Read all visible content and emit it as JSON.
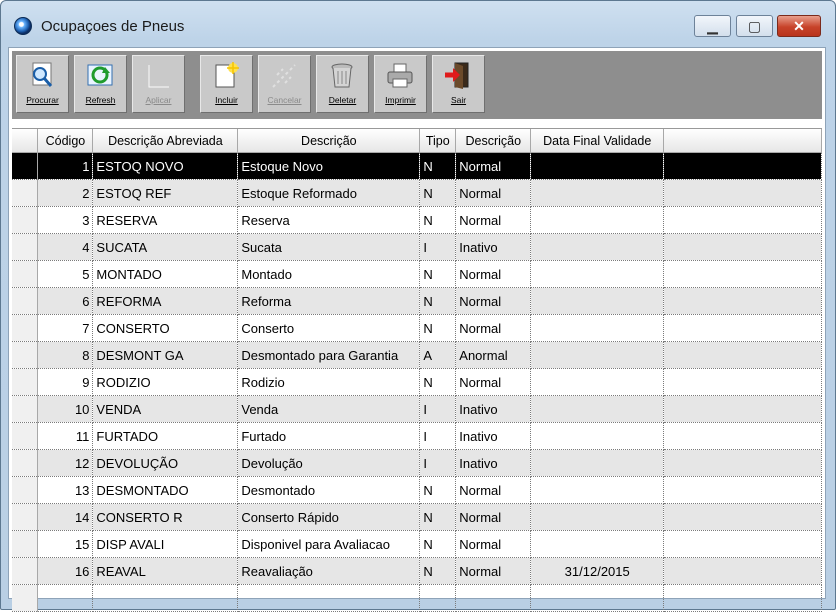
{
  "window": {
    "title": "Ocupaçoes de Pneus"
  },
  "toolbar": {
    "buttons": [
      {
        "label": "Procurar",
        "icon": "search-icon",
        "enabled": true
      },
      {
        "label": "Refresh",
        "icon": "refresh-icon",
        "enabled": true
      },
      {
        "label": "Aplicar",
        "icon": "apply-icon",
        "enabled": false
      },
      {
        "label": "Incluir",
        "icon": "new-document-icon",
        "enabled": true
      },
      {
        "label": "Cancelar",
        "icon": "cancel-icon",
        "enabled": false
      },
      {
        "label": "Deletar",
        "icon": "trash-icon",
        "enabled": true
      },
      {
        "label": "Imprimir",
        "icon": "printer-icon",
        "enabled": true
      },
      {
        "label": "Sair",
        "icon": "exit-door-icon",
        "enabled": true
      }
    ]
  },
  "grid": {
    "columns": [
      "Código",
      "Descrição Abreviada",
      "Descrição",
      "Tipo",
      "Descrição",
      "Data Final Validade"
    ],
    "selected_row": 0,
    "rows": [
      {
        "codigo": "1",
        "abrev": "ESTOQ NOVO",
        "descricao": "Estoque Novo",
        "tipo": "N",
        "tipo_desc": "Normal",
        "data": ""
      },
      {
        "codigo": "2",
        "abrev": "ESTOQ REF",
        "descricao": "Estoque Reformado",
        "tipo": "N",
        "tipo_desc": "Normal",
        "data": ""
      },
      {
        "codigo": "3",
        "abrev": "RESERVA",
        "descricao": "Reserva",
        "tipo": "N",
        "tipo_desc": "Normal",
        "data": ""
      },
      {
        "codigo": "4",
        "abrev": "SUCATA",
        "descricao": "Sucata",
        "tipo": "I",
        "tipo_desc": "Inativo",
        "data": ""
      },
      {
        "codigo": "5",
        "abrev": "MONTADO",
        "descricao": "Montado",
        "tipo": "N",
        "tipo_desc": "Normal",
        "data": ""
      },
      {
        "codigo": "6",
        "abrev": "REFORMA",
        "descricao": "Reforma",
        "tipo": "N",
        "tipo_desc": "Normal",
        "data": ""
      },
      {
        "codigo": "7",
        "abrev": "CONSERTO",
        "descricao": "Conserto",
        "tipo": "N",
        "tipo_desc": "Normal",
        "data": ""
      },
      {
        "codigo": "8",
        "abrev": "DESMONT GA",
        "descricao": "Desmontado para Garantia",
        "tipo": "A",
        "tipo_desc": "Anormal",
        "data": ""
      },
      {
        "codigo": "9",
        "abrev": "RODIZIO",
        "descricao": "Rodizio",
        "tipo": "N",
        "tipo_desc": "Normal",
        "data": ""
      },
      {
        "codigo": "10",
        "abrev": "VENDA",
        "descricao": "Venda",
        "tipo": "I",
        "tipo_desc": "Inativo",
        "data": ""
      },
      {
        "codigo": "11",
        "abrev": "FURTADO",
        "descricao": "Furtado",
        "tipo": "I",
        "tipo_desc": "Inativo",
        "data": ""
      },
      {
        "codigo": "12",
        "abrev": "DEVOLUÇÃO",
        "descricao": "Devolução",
        "tipo": "I",
        "tipo_desc": "Inativo",
        "data": ""
      },
      {
        "codigo": "13",
        "abrev": "DESMONTADO",
        "descricao": "Desmontado",
        "tipo": "N",
        "tipo_desc": "Normal",
        "data": ""
      },
      {
        "codigo": "14",
        "abrev": "CONSERTO R",
        "descricao": "Conserto Rápido",
        "tipo": "N",
        "tipo_desc": "Normal",
        "data": ""
      },
      {
        "codigo": "15",
        "abrev": "DISP AVALI",
        "descricao": "Disponivel para Avaliacao",
        "tipo": "N",
        "tipo_desc": "Normal",
        "data": ""
      },
      {
        "codigo": "16",
        "abrev": "REAVAL",
        "descricao": "Reavaliação",
        "tipo": "N",
        "tipo_desc": "Normal",
        "data": "31/12/2015"
      }
    ]
  }
}
